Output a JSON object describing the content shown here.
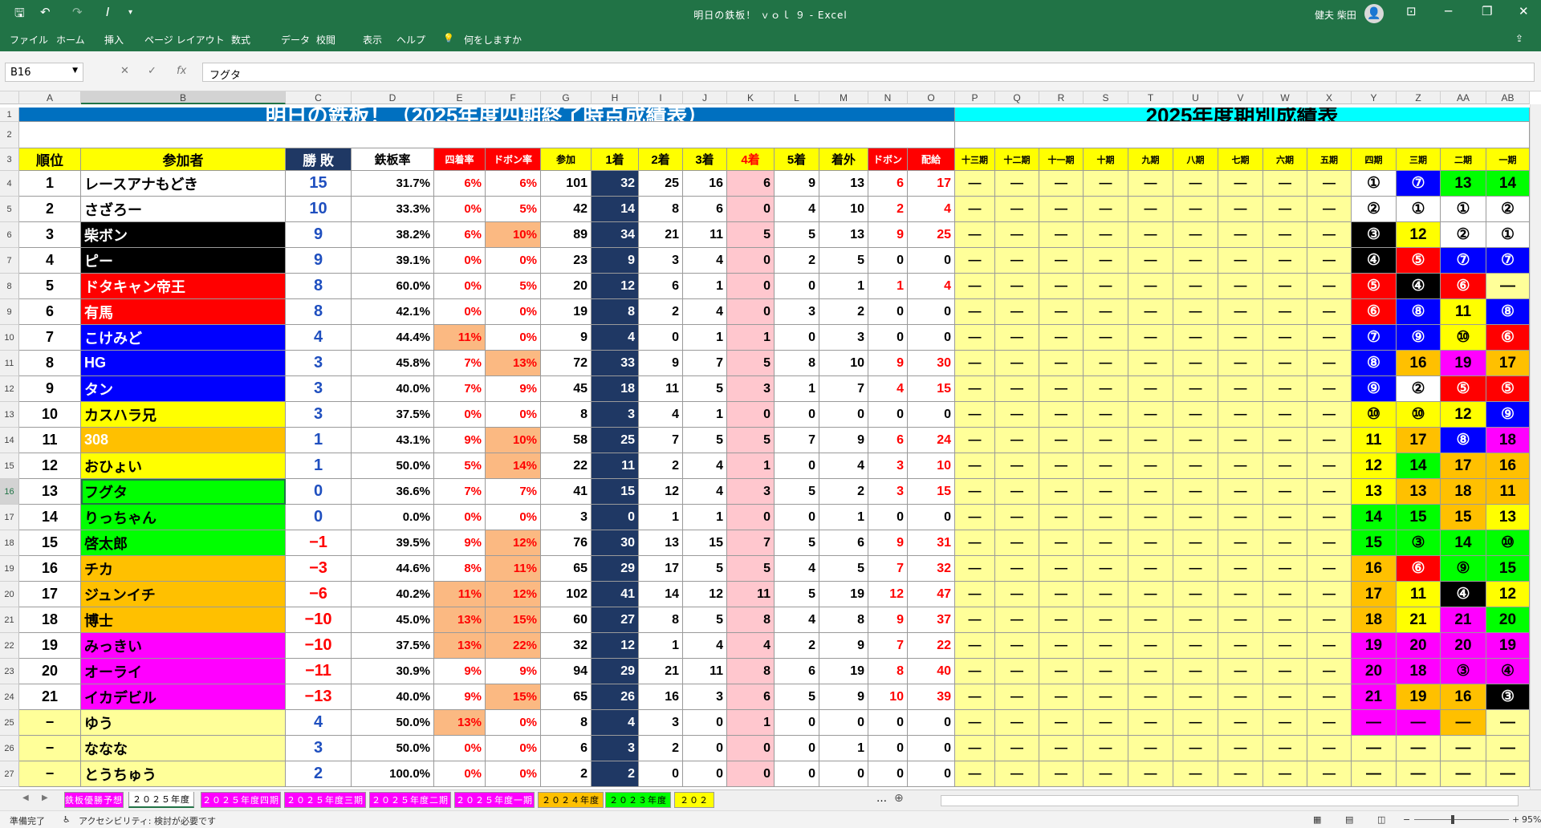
{
  "app": {
    "title": "明日の鉄板！ ｖｏｌ ９ - Excel",
    "user": "健夫 柴田",
    "search": "何をしますか"
  },
  "menu": [
    "ファイル",
    "ホーム",
    "挿入",
    "ページ レイアウト",
    "数式",
    "データ",
    "校閲",
    "表示",
    "ヘルプ"
  ],
  "formula_bar": {
    "name_box": "B16",
    "formula": "フグタ"
  },
  "columns": [
    "A",
    "B",
    "C",
    "D",
    "E",
    "F",
    "G",
    "H",
    "I",
    "J",
    "K",
    "L",
    "M",
    "N",
    "O",
    "P",
    "Q",
    "R",
    "S",
    "T",
    "U",
    "V",
    "W",
    "X",
    "Y",
    "Z",
    "AA",
    "AB"
  ],
  "rows": [
    "1",
    "2",
    "3",
    "4",
    "5",
    "6",
    "7",
    "8",
    "9",
    "10",
    "11",
    "12",
    "13",
    "14",
    "15",
    "16",
    "17",
    "18",
    "19",
    "20",
    "21",
    "22",
    "23",
    "24",
    "25",
    "26",
    "27"
  ],
  "banner_left": "明日の鉄板！（2025年度四期終了時点成績表）",
  "banner_right": "2025年度期別成績表",
  "headers": [
    "順位",
    "参加者",
    "勝 敗",
    "鉄板率",
    "四着率",
    "ドボン率",
    "参加",
    "1着",
    "2着",
    "3着",
    "4着",
    "5着",
    "着外",
    "ドボン",
    "配給",
    "十三期",
    "十二期",
    "十一期",
    "十期",
    "九期",
    "八期",
    "七期",
    "六期",
    "五期",
    "四期",
    "三期",
    "二期",
    "一期"
  ],
  "table": [
    [
      "1",
      "レースアナもどき",
      "15",
      "31.7%",
      "6%",
      "6%",
      "101",
      "32",
      "25",
      "16",
      "6",
      "9",
      "13",
      "6",
      "17",
      "①",
      "⑦",
      "13",
      "14"
    ],
    [
      "2",
      "さざろー",
      "10",
      "33.3%",
      "0%",
      "5%",
      "42",
      "14",
      "8",
      "6",
      "0",
      "4",
      "10",
      "2",
      "4",
      "②",
      "①",
      "①",
      "②"
    ],
    [
      "3",
      "柴ボン",
      "9",
      "38.2%",
      "6%",
      "10%",
      "89",
      "34",
      "21",
      "11",
      "5",
      "5",
      "13",
      "9",
      "25",
      "③",
      "12",
      "②",
      "①"
    ],
    [
      "4",
      "ピー",
      "9",
      "39.1%",
      "0%",
      "0%",
      "23",
      "9",
      "3",
      "4",
      "0",
      "2",
      "5",
      "0",
      "0",
      "④",
      "⑤",
      "⑦",
      "⑦"
    ],
    [
      "5",
      "ドタキャン帝王",
      "8",
      "60.0%",
      "0%",
      "5%",
      "20",
      "12",
      "6",
      "1",
      "0",
      "0",
      "1",
      "1",
      "4",
      "⑤",
      "④",
      "⑥",
      "―"
    ],
    [
      "6",
      "有馬",
      "8",
      "42.1%",
      "0%",
      "0%",
      "19",
      "8",
      "2",
      "4",
      "0",
      "3",
      "2",
      "0",
      "0",
      "⑥",
      "⑧",
      "11",
      "⑧"
    ],
    [
      "7",
      "こけみど",
      "4",
      "44.4%",
      "11%",
      "0%",
      "9",
      "4",
      "0",
      "1",
      "1",
      "0",
      "3",
      "0",
      "0",
      "⑦",
      "⑨",
      "⑩",
      "⑥"
    ],
    [
      "8",
      "HG",
      "3",
      "45.8%",
      "7%",
      "13%",
      "72",
      "33",
      "9",
      "7",
      "5",
      "8",
      "10",
      "9",
      "30",
      "⑧",
      "16",
      "19",
      "17"
    ],
    [
      "9",
      "タン",
      "3",
      "40.0%",
      "7%",
      "9%",
      "45",
      "18",
      "11",
      "5",
      "3",
      "1",
      "7",
      "4",
      "15",
      "⑨",
      "②",
      "⑤",
      "⑤"
    ],
    [
      "10",
      "カスハラ兄",
      "3",
      "37.5%",
      "0%",
      "0%",
      "8",
      "3",
      "4",
      "1",
      "0",
      "0",
      "0",
      "0",
      "0",
      "⑩",
      "⑩",
      "12",
      "⑨"
    ],
    [
      "11",
      "308",
      "1",
      "43.1%",
      "9%",
      "10%",
      "58",
      "25",
      "7",
      "5",
      "5",
      "7",
      "9",
      "6",
      "24",
      "11",
      "17",
      "⑧",
      "18"
    ],
    [
      "12",
      "おひょい",
      "1",
      "50.0%",
      "5%",
      "14%",
      "22",
      "11",
      "2",
      "4",
      "1",
      "0",
      "4",
      "3",
      "10",
      "12",
      "14",
      "17",
      "16"
    ],
    [
      "13",
      "フグタ",
      "0",
      "36.6%",
      "7%",
      "7%",
      "41",
      "15",
      "12",
      "4",
      "3",
      "5",
      "2",
      "3",
      "15",
      "13",
      "13",
      "18",
      "11"
    ],
    [
      "14",
      "りっちゃん",
      "0",
      "0.0%",
      "0%",
      "0%",
      "3",
      "0",
      "1",
      "1",
      "0",
      "0",
      "1",
      "0",
      "0",
      "14",
      "15",
      "15",
      "13"
    ],
    [
      "15",
      "啓太郎",
      "−1",
      "39.5%",
      "9%",
      "12%",
      "76",
      "30",
      "13",
      "15",
      "7",
      "5",
      "6",
      "9",
      "31",
      "15",
      "③",
      "14",
      "⑩"
    ],
    [
      "16",
      "チカ",
      "−3",
      "44.6%",
      "8%",
      "11%",
      "65",
      "29",
      "17",
      "5",
      "5",
      "4",
      "5",
      "7",
      "32",
      "16",
      "⑥",
      "⑨",
      "15"
    ],
    [
      "17",
      "ジュンイチ",
      "−6",
      "40.2%",
      "11%",
      "12%",
      "102",
      "41",
      "14",
      "12",
      "11",
      "5",
      "19",
      "12",
      "47",
      "17",
      "11",
      "④",
      "12"
    ],
    [
      "18",
      "博士",
      "−10",
      "45.0%",
      "13%",
      "15%",
      "60",
      "27",
      "8",
      "5",
      "8",
      "4",
      "8",
      "9",
      "37",
      "18",
      "21",
      "21",
      "20"
    ],
    [
      "19",
      "みっきい",
      "−10",
      "37.5%",
      "13%",
      "22%",
      "32",
      "12",
      "1",
      "4",
      "4",
      "2",
      "9",
      "7",
      "22",
      "19",
      "20",
      "20",
      "19"
    ],
    [
      "20",
      "オーライ",
      "−11",
      "30.9%",
      "9%",
      "9%",
      "94",
      "29",
      "21",
      "11",
      "8",
      "6",
      "19",
      "8",
      "40",
      "20",
      "18",
      "③",
      "④"
    ],
    [
      "21",
      "イカデビル",
      "−13",
      "40.0%",
      "9%",
      "15%",
      "65",
      "26",
      "16",
      "3",
      "6",
      "5",
      "9",
      "10",
      "39",
      "21",
      "19",
      "16",
      "③"
    ],
    [
      "−",
      "ゆう",
      "4",
      "50.0%",
      "13%",
      "0%",
      "8",
      "4",
      "3",
      "0",
      "1",
      "0",
      "0",
      "0",
      "0",
      "―",
      "―",
      "―",
      "―"
    ],
    [
      "−",
      "ななな",
      "3",
      "50.0%",
      "0%",
      "0%",
      "6",
      "3",
      "2",
      "0",
      "0",
      "0",
      "1",
      "0",
      "0",
      "―",
      "―",
      "―",
      "―"
    ],
    [
      "−",
      "とうちゅう",
      "2",
      "100.0%",
      "0%",
      "0%",
      "2",
      "2",
      "0",
      "0",
      "0",
      "0",
      "0",
      "0",
      "0",
      "―",
      "―",
      "―",
      "―"
    ]
  ],
  "dash": "―",
  "sheet_tabs": [
    "鉄板優勝予想",
    "２０２５年度",
    "２０２５年度四期",
    "２０２５年度三期",
    "２０２５年度二期",
    "２０２５年度一期",
    "２０２４年度",
    "２０２３年度",
    "２０２"
  ],
  "status": {
    "ready": "準備完了",
    "accessibility": "アクセシビリティ: 検討が必要です",
    "zoom": "95%"
  },
  "colors": {
    "excel_green": "#217346",
    "header_blue": "#0070c0",
    "cyan": "#00ffff",
    "navy": "#1f3864",
    "pale_yellow": "#ffff99",
    "salmon": "#fbb982"
  }
}
